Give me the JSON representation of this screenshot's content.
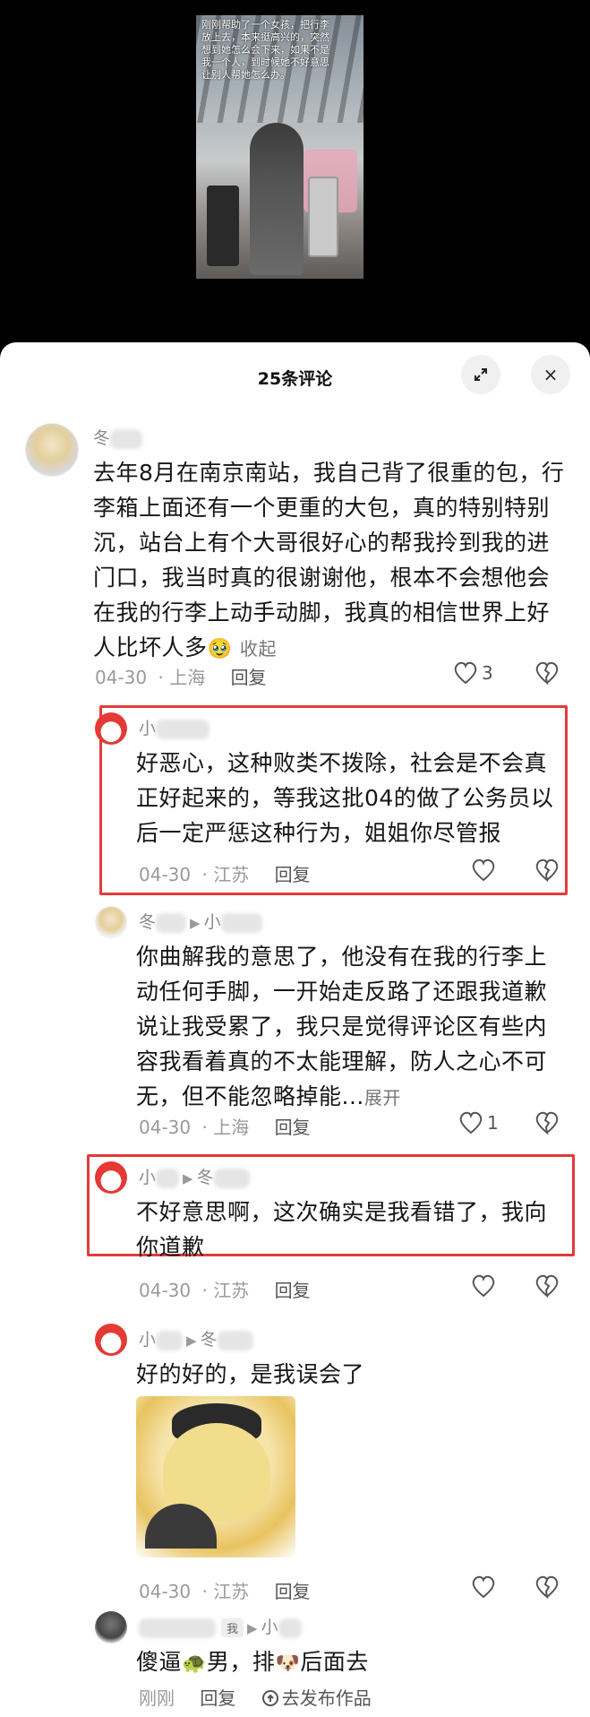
{
  "video": {
    "caption": "刚刚帮助了一个女孩，把行李放上去，本来挺高兴的，突然想到她怎么会下来，如果不是我一个人，到时候她不好意思让别人帮她怎么办。"
  },
  "sheet": {
    "title": "25条评论",
    "expand_icon": "expand-icon",
    "close_icon": "×"
  },
  "comments": [
    {
      "name_prefix": "冬",
      "text": "去年8月在南京南站，我自己背了很重的包，行李箱上面还有一个更重的大包，真的特别特别沉，站台上有个大哥很好心的帮我拎到我的进门口，我当时真的很谢谢他，根本不会想他会在我的行李上动手动脚，我真的相信世界上好人比坏人多",
      "emoji": "🥹",
      "collapse_label": "收起",
      "time": "04-30",
      "location": "上海",
      "reply_label": "回复",
      "likes": "3"
    },
    {
      "name_prefix": "小",
      "text": "好恶心，这种败类不拨除，社会是不会真正好起来的，等我这批04的做了公务员以后一定严惩这种行为，姐姐你尽管报",
      "time": "04-30",
      "location": "江苏",
      "reply_label": "回复"
    },
    {
      "name_prefix": "冬",
      "reply_to": "小",
      "text": "你曲解我的意思了，他没有在我的行李上动任何手脚，一开始走反路了还跟我道歉说让我受累了，我只是觉得评论区有些内容我看着真的不太能理解，防人之心不可无，但不能忽略掉能...",
      "expand_label": "展开",
      "time": "04-30",
      "location": "上海",
      "reply_label": "回复",
      "likes": "1"
    },
    {
      "name_prefix": "小",
      "reply_to": "冬",
      "text": "不好意思啊，这次确实是我看错了，我向你道歉",
      "time": "04-30",
      "location": "江苏",
      "reply_label": "回复"
    },
    {
      "name_prefix": "小",
      "reply_to": "冬",
      "text": "好的好的，是我误会了",
      "time": "04-30",
      "location": "江苏",
      "reply_label": "回复"
    },
    {
      "badge": "我",
      "reply_to": "小",
      "text_a": "傻逼",
      "emoji_a": "🐢",
      "text_b": "男，排",
      "emoji_b": "🐶",
      "text_c": "后面去",
      "time": "刚刚",
      "reply_label": "回复",
      "share_label": "去发布作品"
    }
  ],
  "colors": {
    "highlight_box": "#e23b3b",
    "meta_text": "#9a9a9a"
  }
}
